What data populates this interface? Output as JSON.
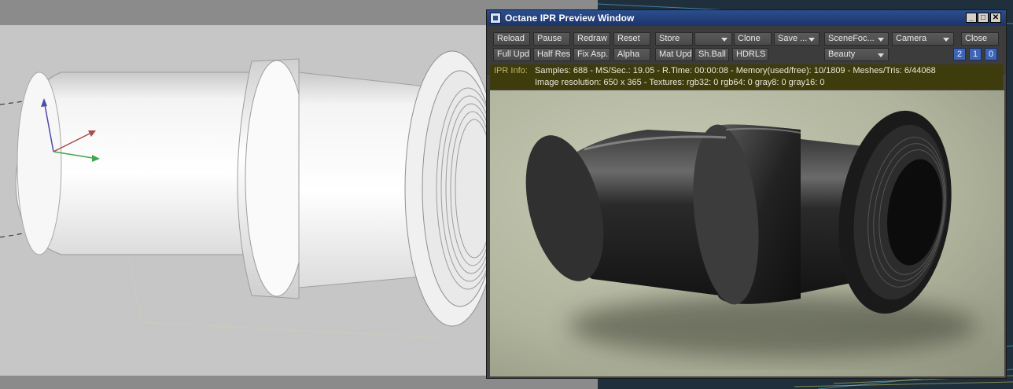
{
  "window": {
    "title": "Octane IPR Preview Window",
    "controls": {
      "minimize": "_",
      "maximize": "□",
      "close": "✕"
    }
  },
  "toolbar": {
    "row1": {
      "reload": "Reload",
      "pause": "Pause",
      "redraw": "Redraw",
      "reset": "Reset",
      "store": "Store",
      "store_slot": "",
      "clone": "Clone",
      "save": "Save ...",
      "scene_focus": "SceneFoc...",
      "camera": "Camera",
      "close": "Close"
    },
    "row2": {
      "full_update": "Full Upd.",
      "half_res": "Half Res",
      "fix_aspect": "Fix Asp.",
      "alpha": "Alpha",
      "mat_update": "Mat Upd",
      "sh_ball": "Sh.Ball",
      "hdrls": "HDRLS",
      "render_pass": "Beauty",
      "num_2": "2",
      "num_1": "1",
      "num_0": "0"
    }
  },
  "info": {
    "label": "IPR Info:",
    "line1": "Samples: 688  -  MS/Sec.: 19.05  -  R.Time: 00:00:08 - Memory(used/free): 10/1809  -  Meshes/Tris: 6/44068",
    "line2": "Image resolution: 650 x 365 - Textures:  rgb32: 0   rgb64: 0   gray8: 0   gray16: 0"
  },
  "colors": {
    "titlebar": "#1c3468",
    "info_bg": "#3e3b0c",
    "number_buttons": "#3d64b5",
    "render_bg": "#b7bba4"
  }
}
